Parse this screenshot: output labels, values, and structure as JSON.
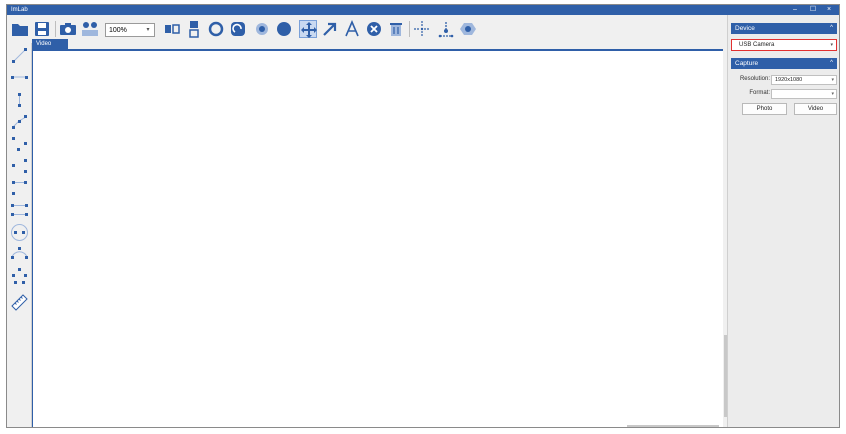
{
  "window": {
    "title": "ImLab",
    "controls": {
      "minimize": "–",
      "maximize": "☐",
      "close": "×"
    }
  },
  "toolbar": {
    "zoom_value": "100%",
    "zoom_arrow": "▾",
    "icons": [
      "folder-open-icon",
      "save-icon",
      "camera-icon",
      "dual-view-icon",
      "fit-width-icon",
      "fit-height-icon",
      "ring-icon",
      "rotate-icon",
      "circle-dot-icon",
      "filled-circle-icon",
      "move-icon",
      "arrow-icon",
      "text-icon",
      "delete-icon",
      "trash-icon",
      "crosshair-icon",
      "measure-icon",
      "settings-icon"
    ]
  },
  "left_tools": {
    "icons": [
      "point-icon",
      "line-icon",
      "segment-icon",
      "polyline-icon",
      "vertical-line-icon",
      "angle-icon",
      "parallel-icon",
      "rectangle-icon",
      "circle-icon",
      "arc-icon",
      "multi-point-icon",
      "scale-icon"
    ]
  },
  "video_tab": {
    "label": "Video"
  },
  "right_panel": {
    "device": {
      "header": "Device",
      "caret": "^",
      "selected": "USB Camera",
      "arrow": "▾"
    },
    "capture": {
      "header": "Capture",
      "caret": "^",
      "resolution_label": "Resolution:",
      "resolution_value": "1920x1080",
      "format_label": "Format:",
      "format_value": "",
      "arrow": "▾",
      "photo_button": "Photo",
      "video_button": "Video"
    }
  },
  "colors": {
    "accent": "#2f5fa8",
    "highlight_border": "#e23030"
  }
}
